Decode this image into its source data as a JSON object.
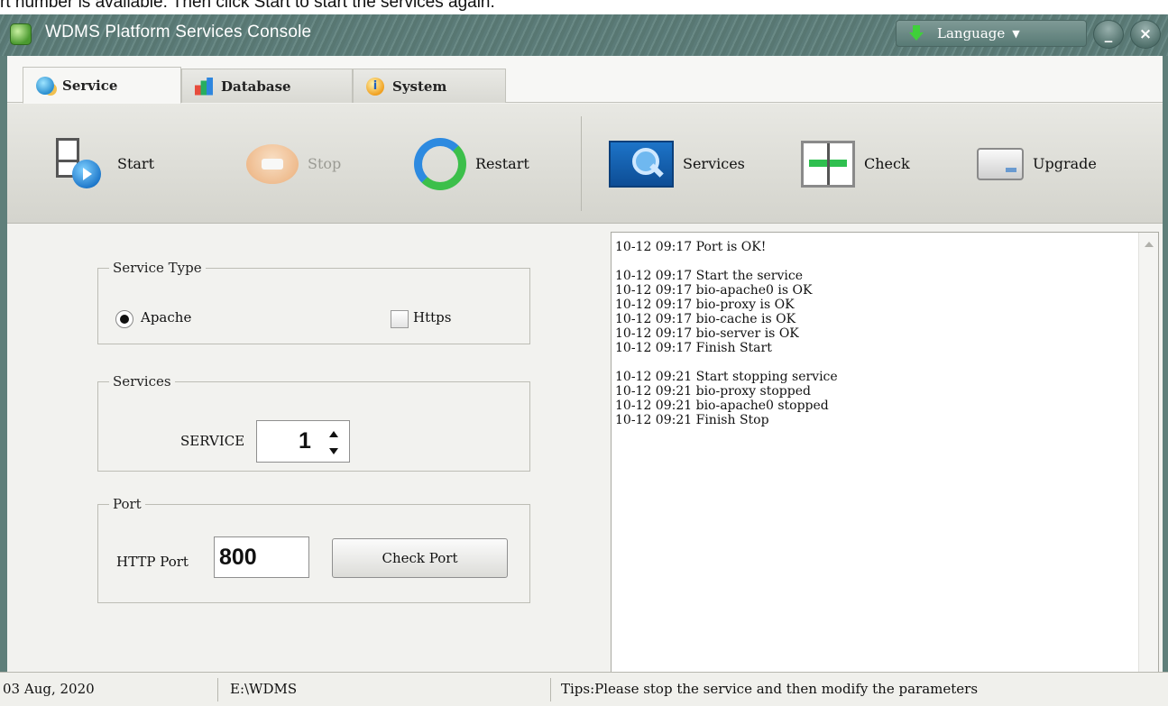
{
  "banner_text": "rt number is available. Then click Start to start the services again.",
  "window": {
    "title": "WDMS Platform Services Console",
    "language_label": "Language",
    "minimize_glyph": "_",
    "close_glyph": "×"
  },
  "tabs": [
    {
      "label": "Service",
      "icon": "service-globe-icon",
      "active": true
    },
    {
      "label": "Database",
      "icon": "database-chart-icon",
      "active": false
    },
    {
      "label": "System",
      "icon": "system-info-icon",
      "active": false
    }
  ],
  "toolbar": {
    "start": "Start",
    "stop": "Stop",
    "restart": "Restart",
    "services": "Services",
    "check": "Check",
    "upgrade": "Upgrade"
  },
  "service_type": {
    "legend": "Service Type",
    "apache_label": "Apache",
    "apache_selected": true,
    "https_label": "Https",
    "https_checked": false
  },
  "services": {
    "legend": "Services",
    "service_label": "SERVICE",
    "service_count": "1"
  },
  "port": {
    "legend": "Port",
    "http_label": "HTTP Port",
    "http_value": "800",
    "check_button": "Check Port"
  },
  "log": {
    "text": "10-12 09:17 Port is OK!\n\n10-12 09:17 Start the service\n10-12 09:17 bio-apache0 is OK\n10-12 09:17 bio-proxy is OK\n10-12 09:17 bio-cache is OK\n10-12 09:17 bio-server is OK\n10-12 09:17 Finish Start\n\n10-12 09:21 Start stopping service\n10-12 09:21 bio-proxy stopped\n10-12 09:21 bio-apache0 stopped\n10-12 09:21 Finish Stop"
  },
  "status": {
    "date": "03 Aug, 2020",
    "path": "E:\\WDMS",
    "tips": "Tips:Please stop the service and then modify the parameters"
  }
}
